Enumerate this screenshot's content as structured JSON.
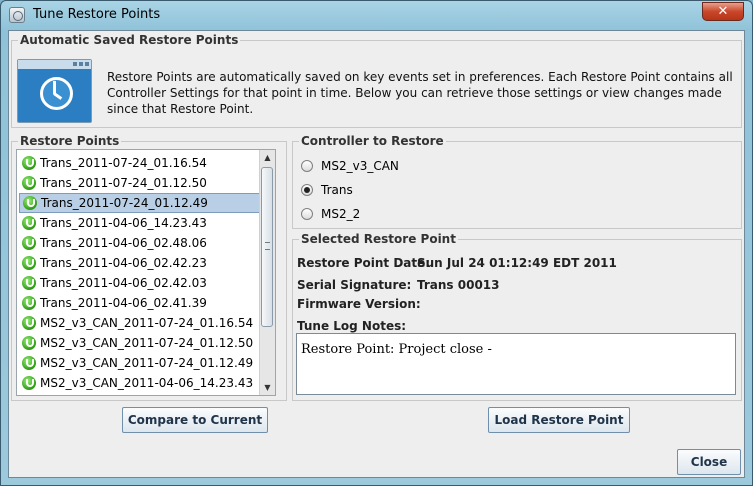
{
  "window": {
    "title": "Tune Restore Points"
  },
  "header": {
    "title": "Automatic Saved Restore Points",
    "description": "Restore Points are automatically saved on key events set in preferences. Each Restore Point contains all Controller Settings for that point in time. Below you can retrieve those settings or view changes made since that Restore Point."
  },
  "restore_points": {
    "title": "Restore Points",
    "items": [
      {
        "label": "Trans_2011-07-24_01.16.54"
      },
      {
        "label": "Trans_2011-07-24_01.12.50"
      },
      {
        "label": "Trans_2011-07-24_01.12.49",
        "selected": true
      },
      {
        "label": "Trans_2011-04-06_14.23.43"
      },
      {
        "label": "Trans_2011-04-06_02.48.06"
      },
      {
        "label": "Trans_2011-04-06_02.42.23"
      },
      {
        "label": "Trans_2011-04-06_02.42.03"
      },
      {
        "label": "Trans_2011-04-06_02.41.39"
      },
      {
        "label": "MS2_v3_CAN_2011-07-24_01.16.54"
      },
      {
        "label": "MS2_v3_CAN_2011-07-24_01.12.50"
      },
      {
        "label": "MS2_v3_CAN_2011-07-24_01.12.49"
      },
      {
        "label": "MS2_v3_CAN_2011-04-06_14.23.43"
      }
    ]
  },
  "controller": {
    "title": "Controller to Restore",
    "options": [
      {
        "label": "MS2_v3_CAN",
        "checked": false
      },
      {
        "label": "Trans",
        "checked": true
      },
      {
        "label": "MS2_2",
        "checked": false
      }
    ]
  },
  "selected_point": {
    "title": "Selected Restore Point",
    "date_label": "Restore Point Date:",
    "date_value": "Sun Jul 24 01:12:49 EDT 2011",
    "serial_label": "Serial Signature:",
    "serial_value": "Trans 00013",
    "firmware_label": "Firmware Version:",
    "firmware_value": "",
    "notes_label": "Tune Log Notes:",
    "notes_value": "Restore Point: Project close -"
  },
  "buttons": {
    "compare": "Compare to Current",
    "load": "Load Restore Point",
    "close": "Close"
  },
  "colors": {
    "accent": "#2b7ec1",
    "selection": "#b8cfe5",
    "status_icon": "#2e9a14"
  }
}
